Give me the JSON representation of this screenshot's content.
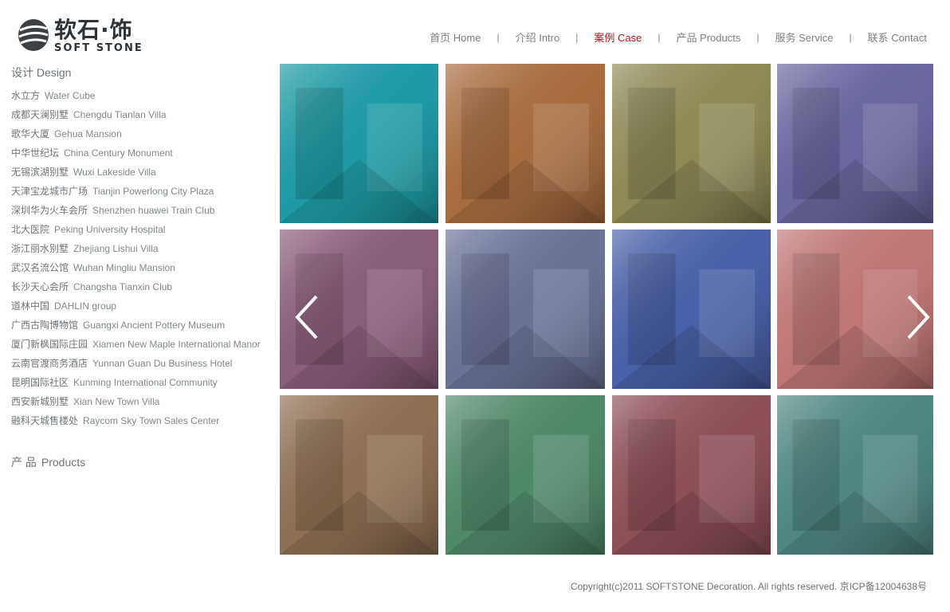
{
  "brand": {
    "name_cn": "软石·饰",
    "name_en": "SOFT STONE"
  },
  "nav": {
    "items": [
      {
        "label": "首页 Home",
        "active": false
      },
      {
        "label": "介绍 Intro",
        "active": false
      },
      {
        "label": "案例 Case",
        "active": true
      },
      {
        "label": "产品 Products",
        "active": false
      },
      {
        "label": "服务 Service",
        "active": false
      },
      {
        "label": "联系 Contact",
        "active": false
      }
    ],
    "separator": "|"
  },
  "sidebar": {
    "design_title": "设计 Design",
    "projects": [
      {
        "cn": "水立方",
        "en": "Water Cube"
      },
      {
        "cn": "成都天澜别墅",
        "en": "Chengdu Tianlan Villa"
      },
      {
        "cn": "歌华大厦",
        "en": "Gehua Mansion"
      },
      {
        "cn": "中华世纪坛",
        "en": "China Century Monument"
      },
      {
        "cn": "无锡滨湖别墅",
        "en": "Wuxi Lakeside Villa"
      },
      {
        "cn": "天津宝龙城市广场",
        "en": "Tianjin Powerlong City Plaza"
      },
      {
        "cn": "深圳华为火车会所",
        "en": "Shenzhen huawei Train Club"
      },
      {
        "cn": "北大医院",
        "en": "Peking University Hospital"
      },
      {
        "cn": "浙江丽水别墅",
        "en": "Zhejiang Lishui Villa"
      },
      {
        "cn": "武汉名流公馆",
        "en": "Wuhan Mingliu Mansion"
      },
      {
        "cn": "长沙天心会所",
        "en": "Changsha Tianxin Club"
      },
      {
        "cn": "道林中国",
        "en": "DAHLIN group"
      },
      {
        "cn": "广西古陶博物馆",
        "en": "Guangxi Ancient Pottery Museum"
      },
      {
        "cn": "厦门新枫国际庄园",
        "en": "Xiamen New Maple International Manor"
      },
      {
        "cn": "云南官渡商务酒店",
        "en": "Yunnan Guan Du Business Hotel"
      },
      {
        "cn": "昆明国际社区",
        "en": "Kunming International Community"
      },
      {
        "cn": "西安新城别墅",
        "en": "Xian New Town Villa"
      },
      {
        "cn": "融科天城售楼处",
        "en": "Raycom Sky Town Sales Center"
      }
    ],
    "products_title_cn": "产 品",
    "products_title_en": "Products"
  },
  "gallery": {
    "tiles": [
      {
        "tone": "#1f9aa6"
      },
      {
        "tone": "#a86d3f"
      },
      {
        "tone": "#8e8a55"
      },
      {
        "tone": "#6a67a0"
      },
      {
        "tone": "#8a5e7a"
      },
      {
        "tone": "#6b7396"
      },
      {
        "tone": "#4a60a8"
      },
      {
        "tone": "#c07676"
      },
      {
        "tone": "#8e7055"
      },
      {
        "tone": "#4f8a6a"
      },
      {
        "tone": "#8e4f58"
      },
      {
        "tone": "#4f8882"
      }
    ]
  },
  "footer": {
    "copyright": "Copyright(c)2011 SOFTSTONE Decoration. All rights reserved. 京ICP备12004638号"
  }
}
